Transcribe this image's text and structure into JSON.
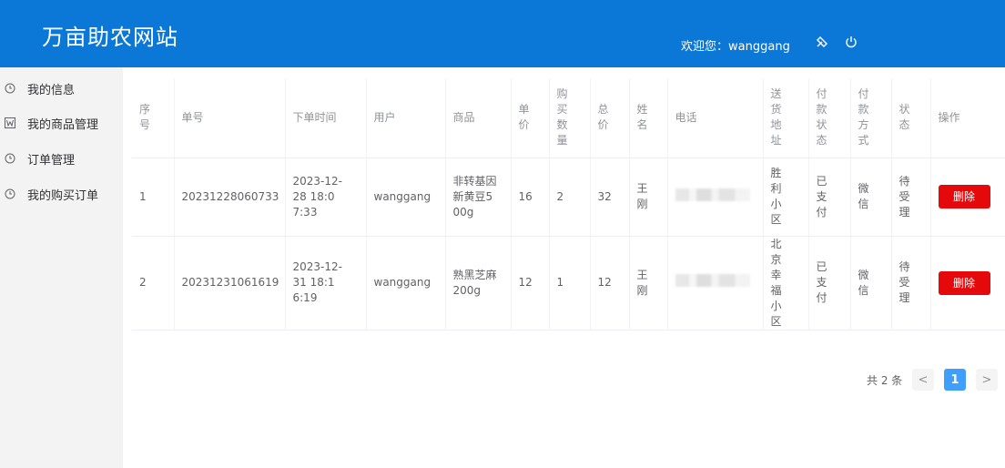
{
  "header": {
    "title": "万亩助农网站",
    "welcome_prefix": "欢迎您：",
    "username": "wanggang",
    "icons": [
      "brush-icon",
      "power-icon"
    ]
  },
  "sidebar": {
    "items": [
      {
        "label": "我的信息",
        "icon": "clock-icon"
      },
      {
        "label": "我的商品管理",
        "icon": "w-box-icon"
      },
      {
        "label": "订单管理",
        "icon": "clock-icon"
      },
      {
        "label": "我的购买订单",
        "icon": "clock-icon"
      }
    ]
  },
  "table": {
    "headers": [
      "序号",
      "单号",
      "下单时间",
      "用户",
      "商品",
      "单价",
      "购买数量",
      "总价",
      "姓名",
      "电话",
      "送货地址",
      "付款状态",
      "付款方式",
      "状态",
      "操作"
    ],
    "rows": [
      {
        "index": "1",
        "order_no": "20231228060733",
        "time": "2023-12-28 18:07:33",
        "user": "wanggang",
        "product": "非转基因新黄豆500g",
        "price": "16",
        "qty": "2",
        "total": "32",
        "name": "王刚",
        "address": "胜利小区",
        "pay_status": "已支付",
        "pay_method": "微信",
        "status": "待受理",
        "action": "删除"
      },
      {
        "index": "2",
        "order_no": "20231231061619",
        "time": "2023-12-31 18:16:19",
        "user": "wanggang",
        "product": "熟黑芝麻200g",
        "price": "12",
        "qty": "1",
        "total": "12",
        "name": "王刚",
        "address": "北京幸福小区",
        "pay_status": "已支付",
        "pay_method": "微信",
        "status": "待受理",
        "action": "删除"
      }
    ]
  },
  "pagination": {
    "total_label": "共 2 条",
    "prev": "<",
    "current": "1",
    "next": ">"
  }
}
